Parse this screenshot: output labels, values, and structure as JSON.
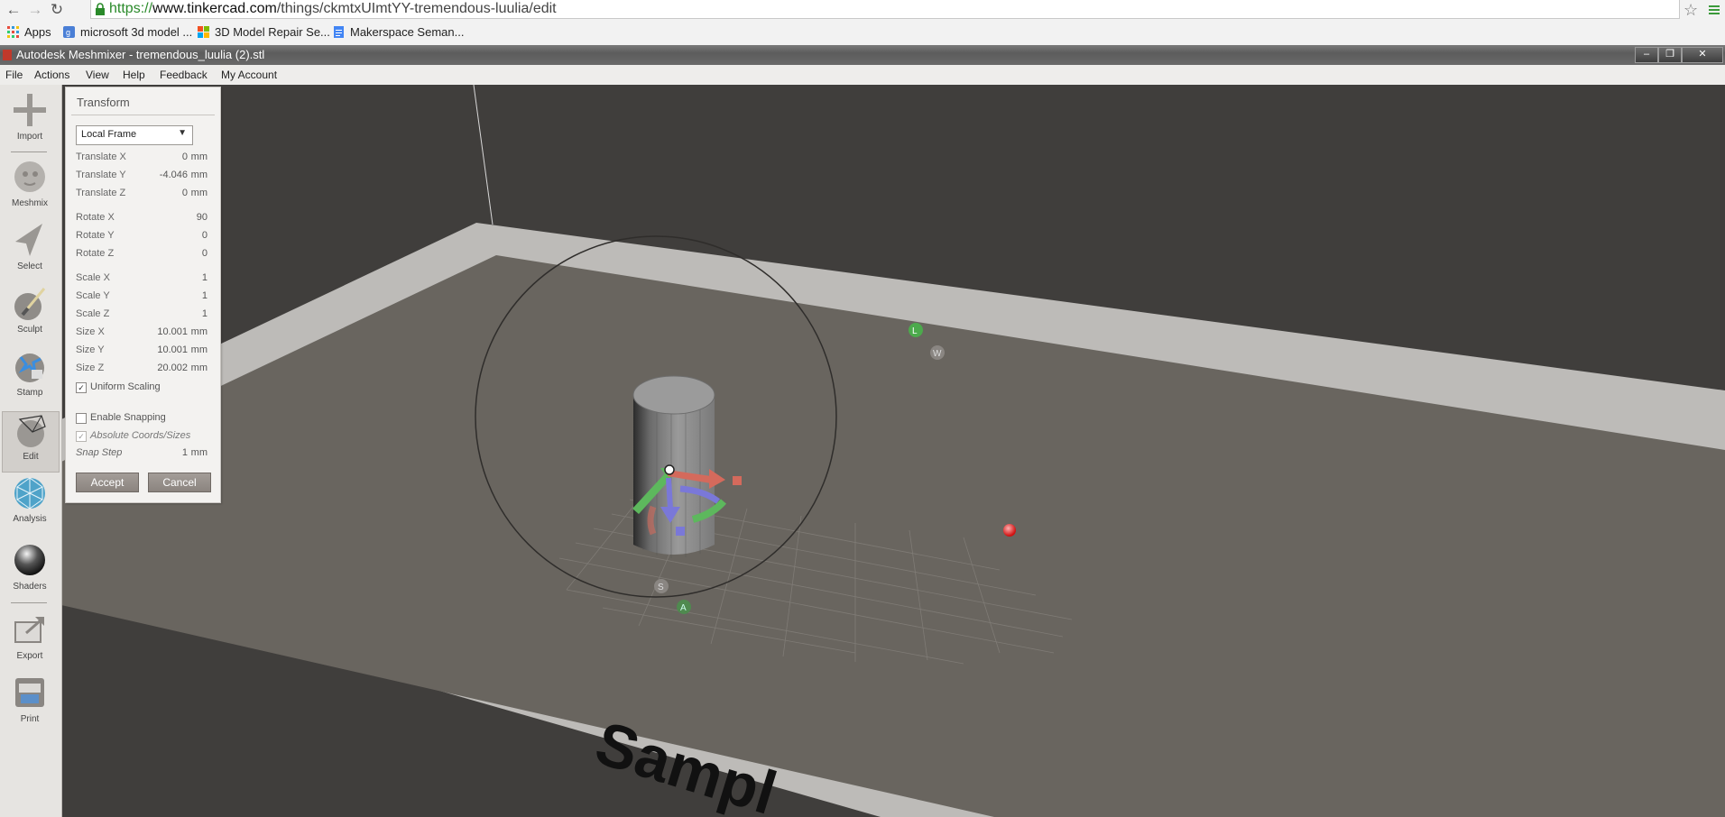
{
  "browser": {
    "url_scheme": "https://",
    "url_host": "www.tinkercad.com",
    "url_path": "/things/ckmtxUImtYY-tremendous-luulia/edit",
    "bookmarks": [
      {
        "label": "Apps",
        "icon": "apps-grid-icon"
      },
      {
        "label": "microsoft 3d model ...",
        "icon": "google-icon"
      },
      {
        "label": "3D Model Repair Se...",
        "icon": "windows-icon"
      },
      {
        "label": "Makerspace Seman...",
        "icon": "document-icon"
      }
    ]
  },
  "app": {
    "title": "Autodesk Meshmixer - tremendous_luulia (2).stl",
    "menu": [
      "File",
      "Actions",
      "View",
      "Help",
      "Feedback",
      "My Account"
    ]
  },
  "toolbar": {
    "tools": [
      "Import",
      "Meshmix",
      "Select",
      "Sculpt",
      "Stamp",
      "Edit",
      "Analysis",
      "Shaders",
      "Export",
      "Print"
    ],
    "active": "Edit"
  },
  "panel": {
    "title": "Transform",
    "frame": "Local Frame",
    "unit": "mm",
    "translate": [
      {
        "label": "Translate X",
        "value": "0"
      },
      {
        "label": "Translate Y",
        "value": "-4.046"
      },
      {
        "label": "Translate Z",
        "value": "0"
      }
    ],
    "rotate": [
      {
        "label": "Rotate X",
        "value": "90"
      },
      {
        "label": "Rotate Y",
        "value": "0"
      },
      {
        "label": "Rotate Z",
        "value": "0"
      }
    ],
    "scale": [
      {
        "label": "Scale X",
        "value": "1"
      },
      {
        "label": "Scale Y",
        "value": "1"
      },
      {
        "label": "Scale Z",
        "value": "1"
      }
    ],
    "size": [
      {
        "label": "Size X",
        "value": "10.001"
      },
      {
        "label": "Size Y",
        "value": "10.001"
      },
      {
        "label": "Size Z",
        "value": "20.002"
      }
    ],
    "uniform_scaling": {
      "label": "Uniform Scaling",
      "checked": true
    },
    "enable_snapping": {
      "label": "Enable Snapping",
      "checked": false
    },
    "absolute_coords": {
      "label": "Absolute Coords/Sizes",
      "checked": true
    },
    "snap_step": {
      "label": "Snap Step",
      "value": "1"
    },
    "accept_label": "Accept",
    "cancel_label": "Cancel"
  },
  "scene": {
    "bed_text": "Sampl",
    "gizmo_labels": [
      "L",
      "W",
      "S",
      "A"
    ]
  }
}
